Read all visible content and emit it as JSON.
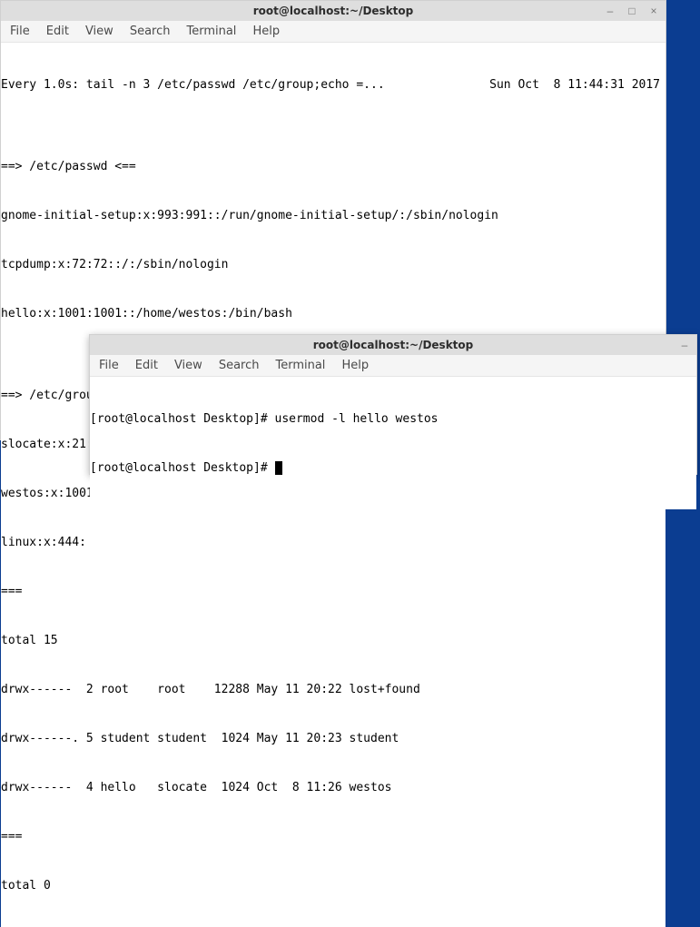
{
  "window_back": {
    "title": "root@localhost:~/Desktop",
    "controls": {
      "min": "–",
      "max": "□",
      "close": "×"
    }
  },
  "window_front": {
    "title": "root@localhost:~/Desktop",
    "controls": {
      "min": "–"
    }
  },
  "menubar": {
    "file": "File",
    "edit": "Edit",
    "view": "View",
    "search": "Search",
    "terminal": "Terminal",
    "help": "Help"
  },
  "back_terminal": {
    "header_left": "Every 1.0s: tail -n 3 /etc/passwd /etc/group;echo =...",
    "header_right": "Sun Oct  8 11:44:31 2017",
    "lines": [
      "",
      "==> /etc/passwd <==",
      "gnome-initial-setup:x:993:991::/run/gnome-initial-setup/:/sbin/nologin",
      "tcpdump:x:72:72::/:/sbin/nologin",
      "hello:x:1001:1001::/home/westos:/bin/bash",
      "",
      "==> /etc/group <==",
      "slocate:x:21:",
      "westos:x:1001:",
      "linux:x:444:",
      "===",
      "total 15",
      "drwx------  2 root    root    12288 May 11 20:22 lost+found",
      "drwx------. 5 student student  1024 May 11 20:23 student",
      "drwx------  4 hello   slocate  1024 Oct  8 11:26 westos",
      "===",
      "total 0"
    ]
  },
  "front_terminal": {
    "line1_prompt": "[root@localhost Desktop]# ",
    "line1_cmd": "usermod -l hello westos",
    "line2_prompt": "[root@localhost Desktop]# "
  }
}
